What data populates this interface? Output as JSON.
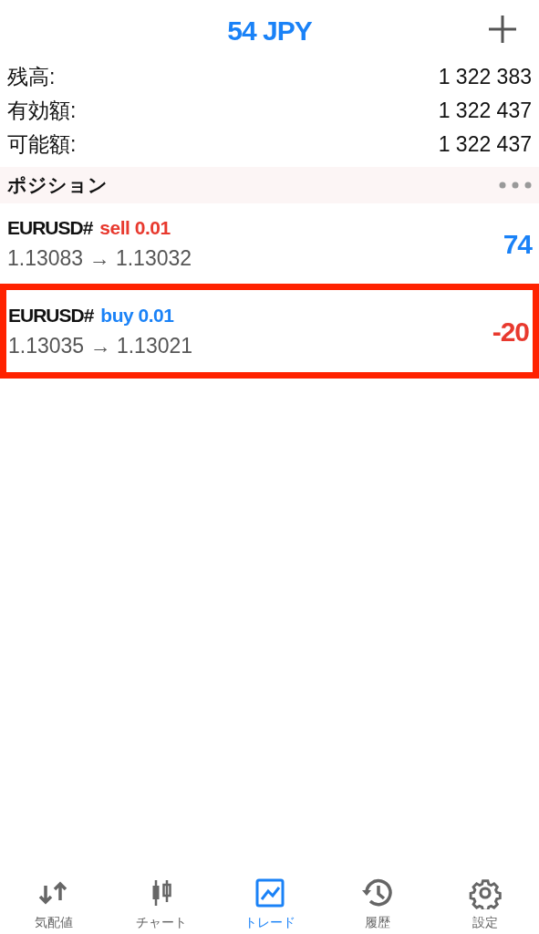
{
  "header": {
    "title": "54 JPY"
  },
  "account": [
    {
      "label": "残高:",
      "value": "1 322 383"
    },
    {
      "label": "有効額:",
      "value": "1 322 437"
    },
    {
      "label": "可能額:",
      "value": "1 322 437"
    }
  ],
  "positions_section": {
    "title": "ポジション"
  },
  "positions": [
    {
      "symbol": "EURUSD#",
      "kind": "sell",
      "order": "sell 0.01",
      "prices": "1.13083 → 1.13032",
      "profit": "74",
      "profit_negative": false,
      "highlighted": false
    },
    {
      "symbol": "EURUSD#",
      "kind": "buy",
      "order": "buy 0.01",
      "prices": "1.13035 → 1.13021",
      "profit": "-20",
      "profit_negative": true,
      "highlighted": true
    }
  ],
  "tab_bar": [
    {
      "kind": "quotes",
      "label": "気配値",
      "selected": false
    },
    {
      "kind": "chart",
      "label": "チャート",
      "selected": false
    },
    {
      "kind": "trade",
      "label": "トレード",
      "selected": true
    },
    {
      "kind": "history",
      "label": "履歴",
      "selected": false
    },
    {
      "kind": "settings",
      "label": "設定",
      "selected": false
    }
  ]
}
